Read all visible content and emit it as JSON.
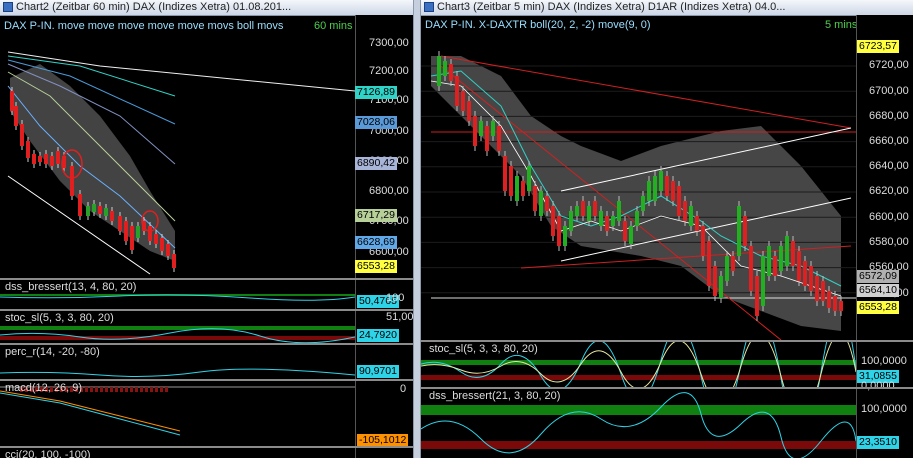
{
  "left": {
    "window_title": "Chart2 (Zeitbar 60 min)  DAX (Indizes Xetra) 01.08.201...",
    "header_text": "DAX P-IN. move move move move move movs boll movs",
    "interval": "60 mins",
    "y_ticks": [
      "7300,00",
      "7200,00",
      "7100,00",
      "7000,00",
      "6900,00",
      "6800,00",
      "6700,00",
      "6600,00"
    ],
    "badges": [
      {
        "text": "7126,89",
        "bg": "#2fd3c7"
      },
      {
        "text": "7028,06",
        "bg": "#5a9ad8"
      },
      {
        "text": "6890,42",
        "bg": "#a8b4d8"
      },
      {
        "text": "6717,29",
        "bg": "#b7d09a"
      },
      {
        "text": "6628,69",
        "bg": "#60a8e8"
      },
      {
        "text": "6553,28",
        "bg": "#ffff40"
      }
    ],
    "indicators": [
      {
        "label": "dss_bressert(13, 4, 80, 20)",
        "value": "50,4765",
        "value2": "100",
        "bg": "#2fd3e7"
      },
      {
        "label": "stoc_sl(5, 3, 3, 80, 20)",
        "value": "24,7920",
        "value2": "51,0000",
        "bg": "#2fd3e7"
      },
      {
        "label": "perc_r(14, -20, -80)",
        "value": "90,9701",
        "value2": "",
        "bg": "#2fd3e7"
      },
      {
        "label": "macd(12, 26, 9)",
        "value": "-105,1012",
        "value2": "0",
        "bg": "#ff9000"
      },
      {
        "label": "cci(20, 100, -100)",
        "value": "",
        "value2": "",
        "bg": ""
      }
    ]
  },
  "right": {
    "window_title": "Chart3 (Zeitbar 5 min)  DAX (Indizes Xetra) D1AR (Indizes Xetra) 04.0...",
    "header_text": "DAX P-IN. X-DAXTR boll(20, 2, -2) move(9, 0)",
    "interval": "5 mins",
    "y_ticks": [
      "6720,00",
      "6700,00",
      "6680,00",
      "6660,00",
      "6640,00",
      "6620,00",
      "6600,00",
      "6580,00",
      "6560,00",
      "6540,00"
    ],
    "badges": [
      {
        "text": "6723,57",
        "bg": "#ffff40"
      },
      {
        "text": "6572,09",
        "bg": "#b0b0b0"
      },
      {
        "text": "6564,10",
        "bg": "#d0d0d0"
      },
      {
        "text": "6553,28",
        "bg": "#ffff40"
      }
    ],
    "indicators": [
      {
        "label": "stoc_sl(5, 3, 3, 80, 20)",
        "value": "31,0855",
        "value2": "100,0000",
        "value3": "0,0000",
        "bg": "#2fd3e7"
      },
      {
        "label": "dss_bressert(21, 3, 80, 20)",
        "value": "23,3510",
        "value2": "100,0000",
        "bg": "#2fd3e7"
      }
    ]
  }
}
